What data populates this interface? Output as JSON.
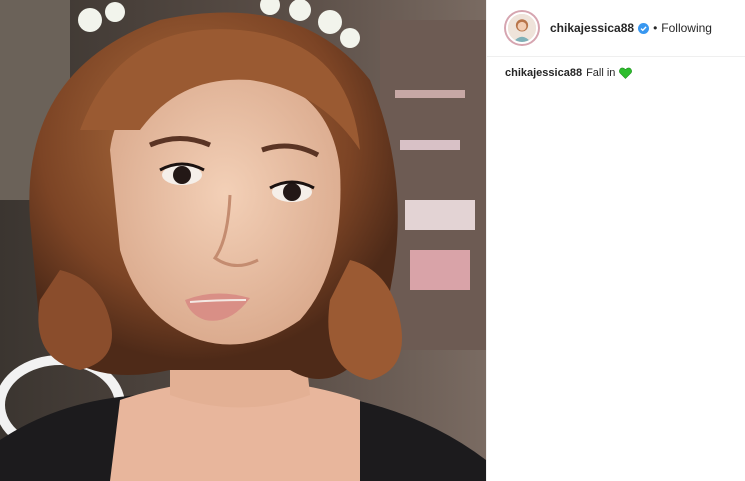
{
  "post": {
    "username": "chikajessica88",
    "separator": "•",
    "follow_status": "Following",
    "caption": {
      "username": "chikajessica88",
      "text": "Fall in",
      "emoji_icon": "green-heart-icon"
    }
  },
  "colors": {
    "text": "#262626",
    "divider": "#efefef",
    "verified": "#3897f0",
    "heart": "#2dbd2d"
  }
}
